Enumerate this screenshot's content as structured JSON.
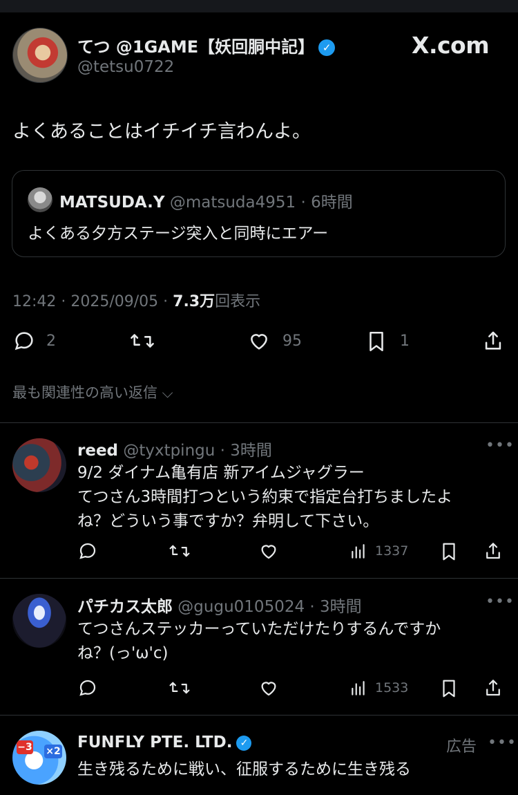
{
  "tweet": {
    "display_name": "てつ @1GAME【妖回胴中記】",
    "handle": "@tetsu0722",
    "text": "よくあることはイチイチ言わんよ。",
    "time": "12:42 · 2025/09/05 · ",
    "views": "7.3万",
    "views_suffix": "回表示",
    "replies": "2",
    "likes": "95",
    "bookmarks": "1"
  },
  "brand": {
    "site": "X.com"
  },
  "quote": {
    "name": "MATSUDA.Y",
    "meta": " @matsuda4951 · 6時間",
    "text": "よくある夕方ステージ突入と同時にエアー"
  },
  "sort_label": "最も関連性の高い返信",
  "replies": [
    {
      "name": "reed",
      "meta": " @tyxtpingu · 3時間",
      "line1": "9/2 ダイナム亀有店 新アイムジャグラー",
      "line2": "てつさん3時間打つという約束で指定台打ちましたよ",
      "line3": "ね？どういう事ですか？弁明して下さい。",
      "views": "1337"
    },
    {
      "name": "パチカス太郎",
      "meta": " @gugu0105024 · 3時間",
      "line1": "てつさんステッカーっていただけたりするんですか",
      "line2": "ね？(っ'ω'c)",
      "views": "1533"
    }
  ],
  "ad": {
    "name": "FUNFLY PTE. LTD.",
    "label": "広告",
    "text": "生き残るために戦い、征服するために生き残る"
  },
  "colors": {
    "background": "#000000",
    "text": "#e7e9ea",
    "muted": "#71767b",
    "verified": "#1d9bf0",
    "border": "#2f3336"
  }
}
